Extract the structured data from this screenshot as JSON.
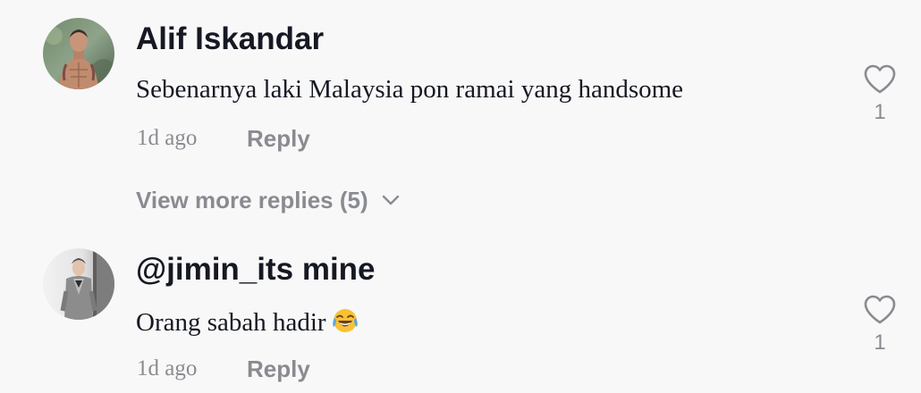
{
  "comments": [
    {
      "username": "Alif Iskandar",
      "text": "Sebenarnya laki Malaysia pon ramai yang handsome",
      "time": "1d ago",
      "reply_label": "Reply",
      "likes": "1",
      "avatar_icon": "profile-photo"
    },
    {
      "username": "@jimin_its mine",
      "text": "Orang sabah hadir",
      "emoji": "face-with-tears-of-joy-emoji",
      "time": "1d ago",
      "reply_label": "Reply",
      "likes": "1",
      "avatar_icon": "profile-photo"
    }
  ],
  "view_more": {
    "label": "View more replies (5)",
    "icon": "chevron-down-icon"
  },
  "colors": {
    "background": "#f8f8f8",
    "primary_text": "#161823",
    "secondary_text": "#8a8b91"
  }
}
